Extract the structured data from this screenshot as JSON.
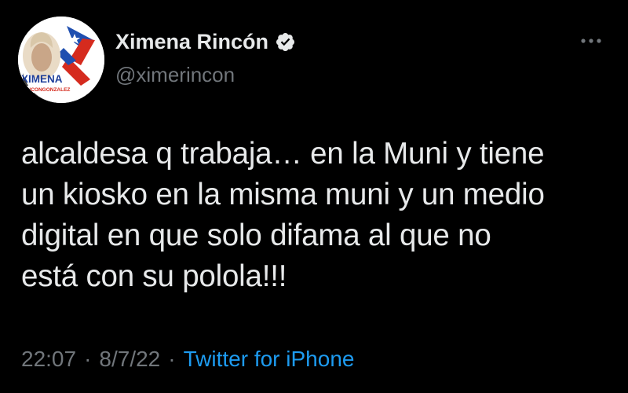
{
  "author": {
    "name": "Ximena Rincón",
    "handle": "@ximerincon",
    "verified_icon": "verified-badge-icon",
    "avatar_logo_text": "XIMENA",
    "avatar_logo_subtext": "RINCONGONZALEZ"
  },
  "menu": {
    "more_icon": "ellipsis-icon"
  },
  "tweet": {
    "text": "alcaldesa q trabaja… en la Muni y tiene\nun kiosko en la misma muni y un medio\ndigital en que solo difama al que no\nestá con su polola!!!",
    "time": "22:07",
    "separator": "·",
    "date": "8/7/22",
    "source": "Twitter for iPhone"
  },
  "colors": {
    "background": "#000000",
    "primary_text": "#e7e9ea",
    "secondary_text": "#71767b",
    "link": "#1d9bf0"
  }
}
